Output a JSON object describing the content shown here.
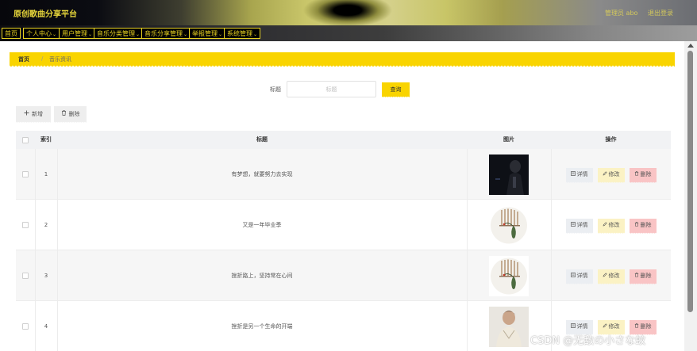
{
  "header": {
    "title": "原创歌曲分享平台",
    "admin_label": "管理员 abo",
    "logout_label": "退出登录"
  },
  "nav": {
    "items": [
      {
        "label": "首页",
        "has_dropdown": false
      },
      {
        "label": "个人中心",
        "has_dropdown": true
      },
      {
        "label": "用户管理",
        "has_dropdown": true
      },
      {
        "label": "音乐分类管理",
        "has_dropdown": true
      },
      {
        "label": "音乐分享管理",
        "has_dropdown": true
      },
      {
        "label": "举报管理",
        "has_dropdown": true
      },
      {
        "label": "系统管理",
        "has_dropdown": true
      }
    ],
    "caret": "⌄"
  },
  "breadcrumb": {
    "home": "首页",
    "separator": "/",
    "current": "音乐资讯"
  },
  "search": {
    "label": "标题",
    "placeholder": "标题",
    "value": "",
    "button_label": "查询"
  },
  "toolbar": {
    "add_label": "新增",
    "add_icon": "plus-icon",
    "delete_label": "删除",
    "delete_icon": "trash-icon"
  },
  "table": {
    "columns": {
      "index": "索引",
      "title": "标题",
      "image": "图片",
      "actions": "操作"
    },
    "rows": [
      {
        "index": "1",
        "title": "有梦想，就要努力去实现",
        "image": "dark-portrait-photo"
      },
      {
        "index": "2",
        "title": "又是一年毕业季",
        "image": "vase-and-blinds-photo"
      },
      {
        "index": "3",
        "title": "挫折路上，坚持常在心间",
        "image": "vase-and-blinds-photo"
      },
      {
        "index": "4",
        "title": "挫折是另一个生命的开端",
        "image": "man-portrait-photo"
      }
    ],
    "actions": {
      "detail": "详情",
      "edit": "修改",
      "delete": "删除"
    }
  },
  "watermark": "CSDN @无敌の小さな蚊",
  "colors": {
    "accent": "#f9d400",
    "nav_text": "#e8d221",
    "detail_bg": "#ebeef2",
    "edit_bg": "#fbf2c4",
    "delete_bg": "#f9c4c5"
  }
}
